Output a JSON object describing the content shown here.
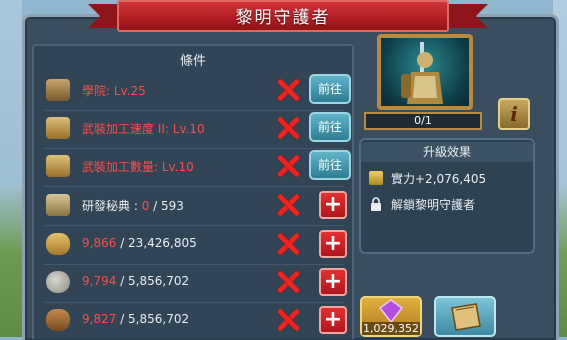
{
  "title": "黎明守護者",
  "conditions": {
    "header": "條件",
    "rows": [
      {
        "icon": "school-icon",
        "text": "學院: Lv.25",
        "met": false,
        "action": "前往"
      },
      {
        "icon": "book-icon",
        "text": "武裝加工速度 II: Lv.10",
        "met": false,
        "action": "前往"
      },
      {
        "icon": "book-icon",
        "text": "武裝加工數量: Lv.10",
        "met": false,
        "action": "前往"
      },
      {
        "icon": "scroll-icon",
        "label": "研發秘典 : ",
        "have": "0",
        "need": "/ 593",
        "met": false,
        "action": "+"
      },
      {
        "icon": "wheat-icon",
        "have": "9,866",
        "need": "/ 23,426,805",
        "met": false,
        "action": "+"
      },
      {
        "icon": "stone-icon",
        "have": "9,794",
        "need": "/ 5,856,702",
        "met": false,
        "action": "+"
      },
      {
        "icon": "wood-icon",
        "have": "9,827",
        "need": "/ 5,856,702",
        "met": false,
        "action": "+"
      }
    ]
  },
  "research": {
    "progress": "0/1",
    "info_label": "i",
    "upgrade_title": "升級效果",
    "effects": [
      {
        "icon": "power-icon",
        "text": "實力+2,076,405"
      },
      {
        "icon": "lock-icon",
        "text": "解鎖黎明守護者"
      }
    ]
  },
  "buttons": {
    "gem_cost": "1,029,352"
  },
  "colors": {
    "ribbon": "#b11e25",
    "unmet_text": "#ff4a4a",
    "go_button": "#2e7d93",
    "plus_button": "#b0161b"
  }
}
